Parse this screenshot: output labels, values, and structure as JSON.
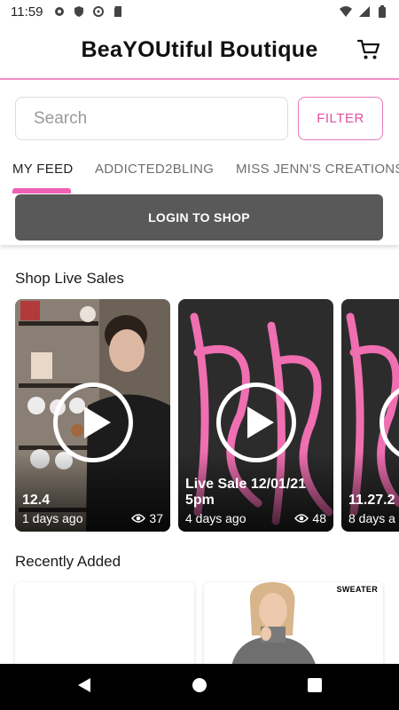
{
  "status_bar": {
    "time": "11:59",
    "left_icons": [
      "gear-icon",
      "shield-icon",
      "sync-icon",
      "sd-card-icon"
    ],
    "right_icons": [
      "wifi-icon",
      "cell-signal-icon",
      "battery-icon"
    ]
  },
  "header": {
    "title": "BeaYOUtiful Boutique",
    "cart_icon": "cart-icon"
  },
  "search": {
    "placeholder": "Search",
    "value": "",
    "filter_label": "FILTER"
  },
  "tabs": [
    {
      "label": "MY FEED",
      "active": true
    },
    {
      "label": "ADDICTED2BLING",
      "active": false
    },
    {
      "label": "MISS JENN'S CREATIONS",
      "active": false
    }
  ],
  "login": {
    "label": "LOGIN TO SHOP"
  },
  "live_sales": {
    "title": "Shop Live Sales",
    "cards": [
      {
        "title": "12.4",
        "age": "1 days ago",
        "views": "37"
      },
      {
        "title": "Live Sale 12/01/21 5pm",
        "age": "4 days ago",
        "views": "48"
      },
      {
        "title": "11.27.2",
        "age": "8 days a",
        "views": ""
      }
    ]
  },
  "recently_added": {
    "title": "Recently Added",
    "items": [
      {
        "label": ""
      },
      {
        "label": "SWEATER"
      }
    ]
  },
  "colors": {
    "accent": "#f060b4",
    "login_bg": "#595959",
    "nav_bg": "#000000"
  }
}
